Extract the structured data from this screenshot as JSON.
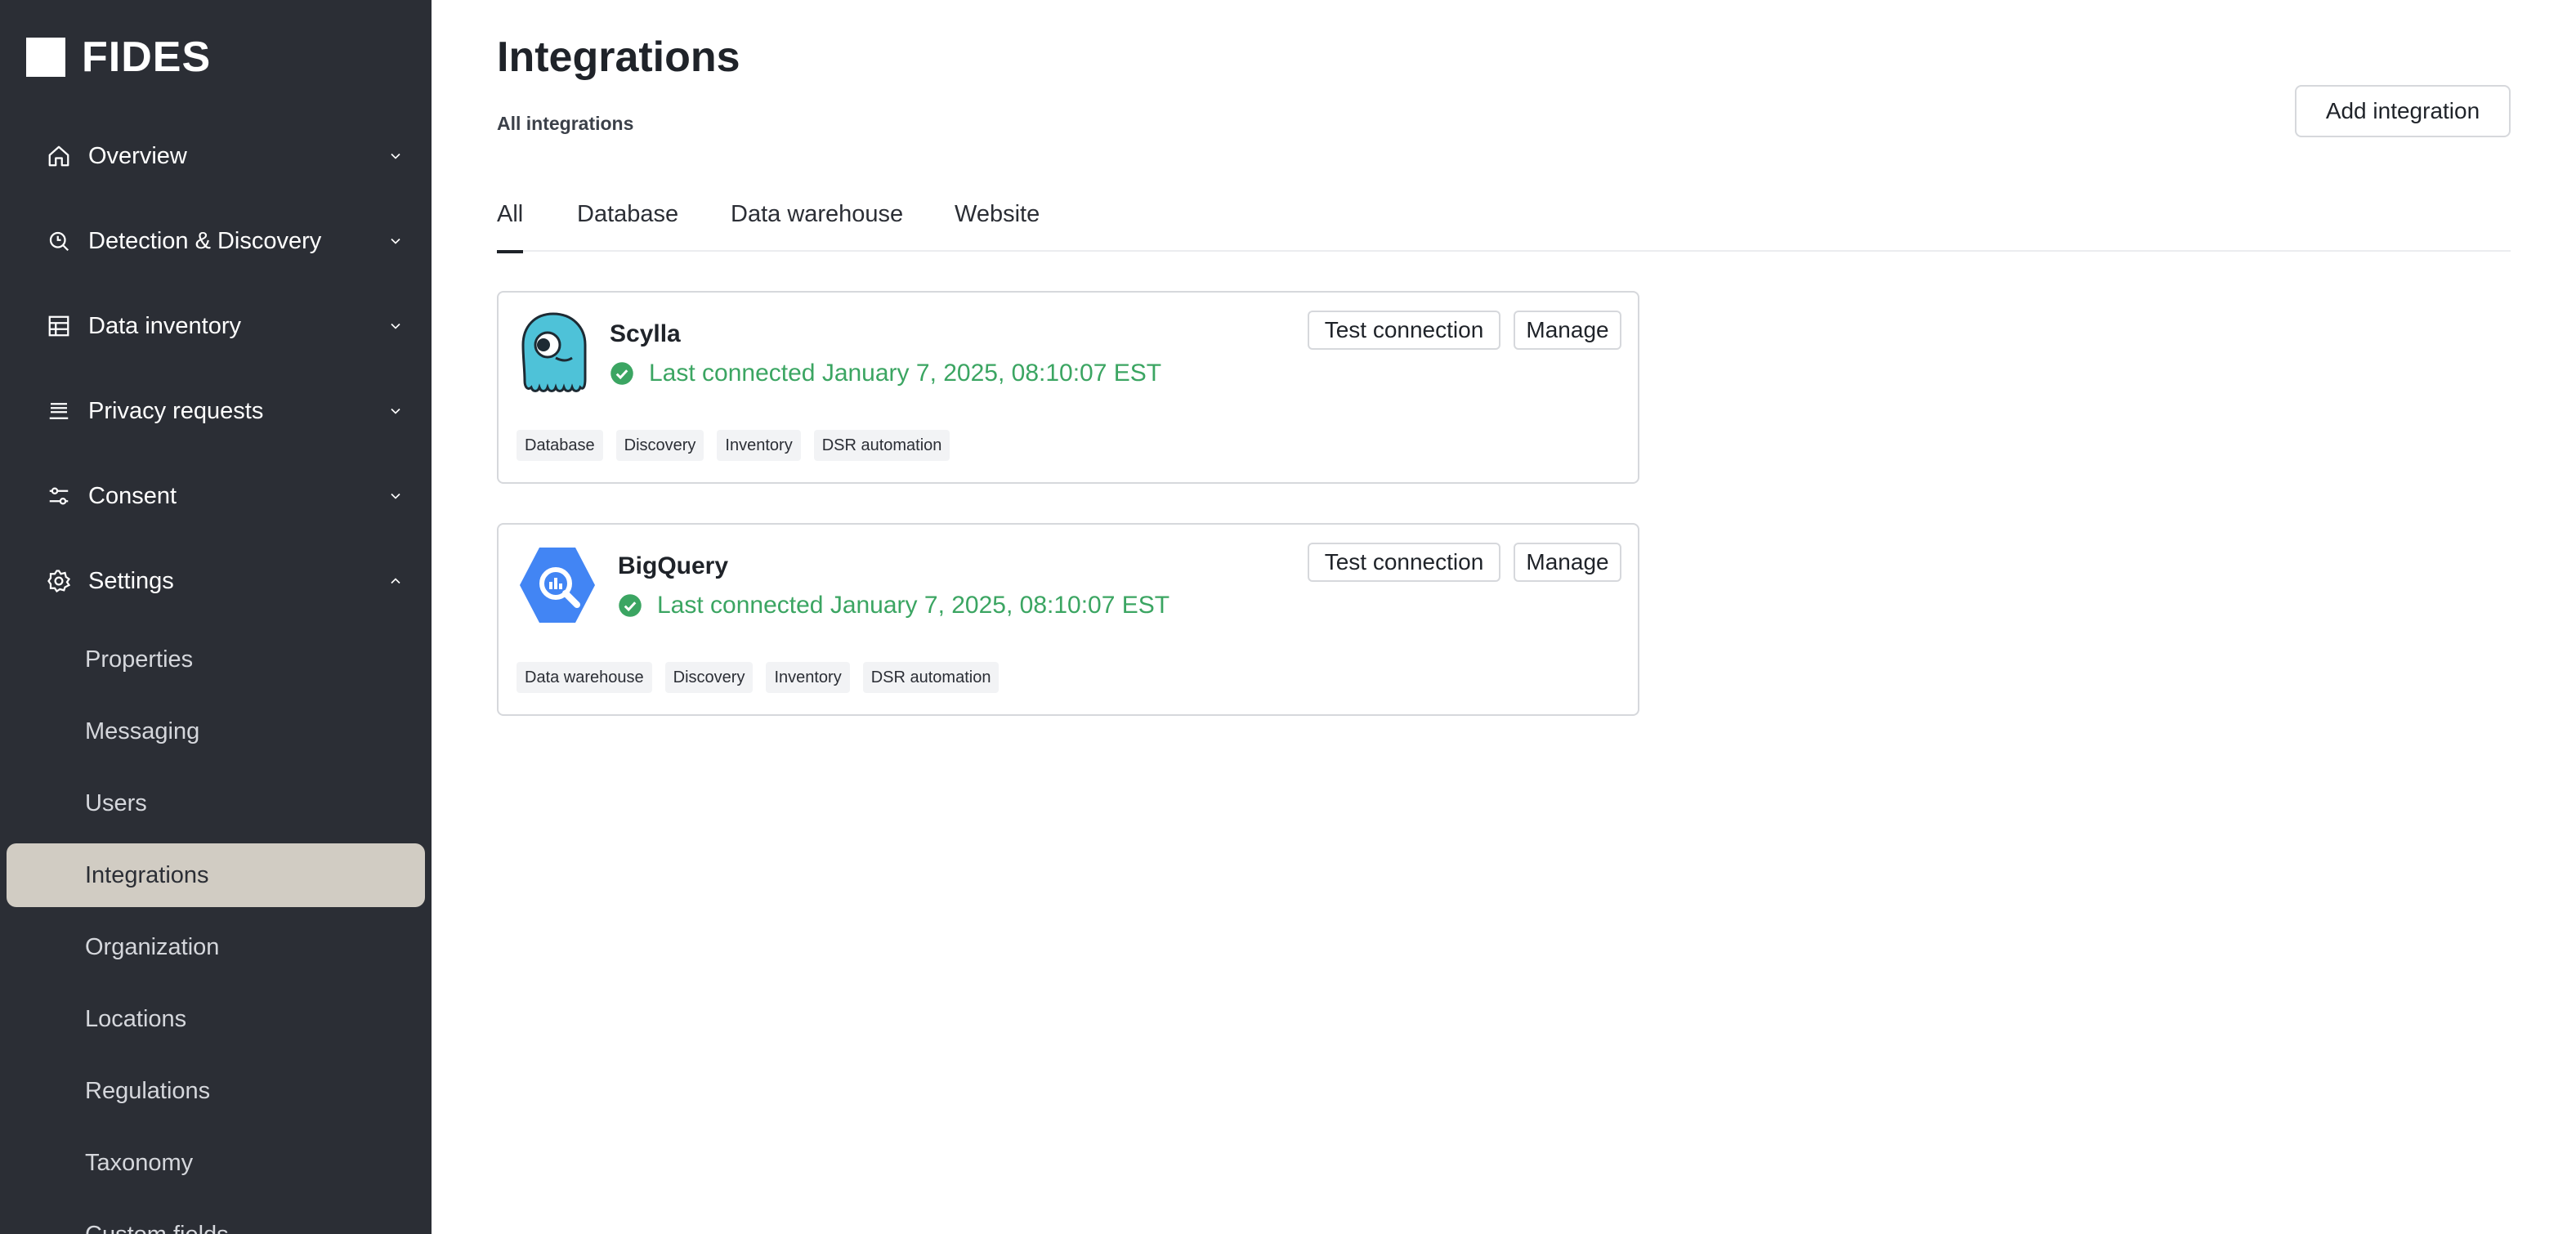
{
  "app": {
    "logo_text": "FIDES"
  },
  "sidebar": {
    "sections": [
      {
        "label": "Overview",
        "icon": "home-icon",
        "expanded": false
      },
      {
        "label": "Detection & Discovery",
        "icon": "radar-search-icon",
        "expanded": false
      },
      {
        "label": "Data inventory",
        "icon": "table-icon",
        "expanded": false
      },
      {
        "label": "Privacy requests",
        "icon": "stack-icon",
        "expanded": false
      },
      {
        "label": "Consent",
        "icon": "sliders-icon",
        "expanded": false
      },
      {
        "label": "Settings",
        "icon": "gear-icon",
        "expanded": true
      }
    ],
    "settings_items": [
      {
        "label": "Properties"
      },
      {
        "label": "Messaging"
      },
      {
        "label": "Users"
      },
      {
        "label": "Integrations",
        "active": true
      },
      {
        "label": "Organization"
      },
      {
        "label": "Locations"
      },
      {
        "label": "Regulations"
      },
      {
        "label": "Taxonomy"
      },
      {
        "label": "Custom fields"
      }
    ]
  },
  "header": {
    "title": "Integrations",
    "breadcrumb": "All integrations",
    "add_button": "Add integration"
  },
  "tabs": [
    {
      "label": "All",
      "active": true
    },
    {
      "label": "Database"
    },
    {
      "label": "Data warehouse"
    },
    {
      "label": "Website"
    }
  ],
  "integrations": [
    {
      "name": "Scylla",
      "logo": "scylla-logo-icon",
      "status": "Last connected January 7, 2025, 08:10:07 EST",
      "test_label": "Test connection",
      "manage_label": "Manage",
      "tags": [
        "Database",
        "Discovery",
        "Inventory",
        "DSR automation"
      ]
    },
    {
      "name": "BigQuery",
      "logo": "bigquery-logo-icon",
      "status": "Last connected January 7, 2025, 08:10:07 EST",
      "test_label": "Test connection",
      "manage_label": "Manage",
      "tags": [
        "Data warehouse",
        "Discovery",
        "Inventory",
        "DSR automation"
      ]
    }
  ],
  "colors": {
    "sidebar_bg": "#2b2e35",
    "active_item_bg": "#d1ccc3",
    "success_green": "#3ba562",
    "bigquery_blue": "#4285f4",
    "scylla_teal": "#4ec2d8"
  }
}
